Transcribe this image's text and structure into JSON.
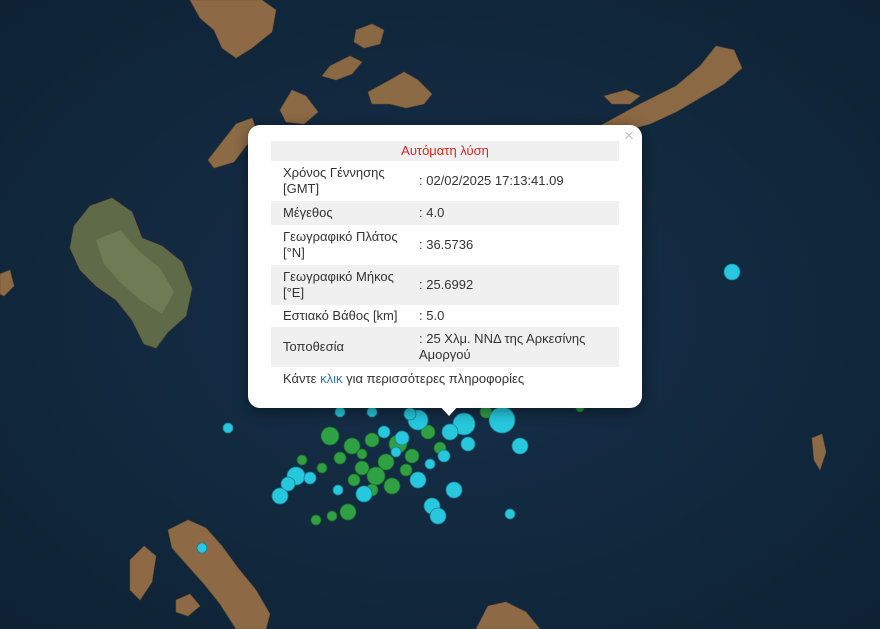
{
  "map": {
    "basemap": "satellite",
    "sea_color": "#13283a",
    "land_color": "#8c6a44",
    "quake_colors": {
      "recent": "#27c8dd",
      "older": "#2fa044"
    }
  },
  "popup": {
    "title": "Αυτόματη λύση",
    "close_label": "×",
    "rows": [
      {
        "label": "Χρόνος Γέννησης [GMT]",
        "value": ": 02/02/2025 17:13:41.09"
      },
      {
        "label": "Μέγεθος",
        "value": ": 4.0"
      },
      {
        "label": "Γεωγραφικό Πλάτος [°N]",
        "value": ": 36.5736"
      },
      {
        "label": "Γεωγραφικό Μήκος [°E]",
        "value": ": 25.6992"
      },
      {
        "label": "Εστιακό Βάθος [km]",
        "value": ": 5.0"
      },
      {
        "label": "Τοποθεσία",
        "value": ": 25 Χλμ. ΝΝΔ της Αρκεσίνης Αμοργού"
      }
    ],
    "more_prefix": "Κάντε",
    "more_link": "κλικ",
    "more_suffix": "για περισσότερες πληροφορίες"
  }
}
